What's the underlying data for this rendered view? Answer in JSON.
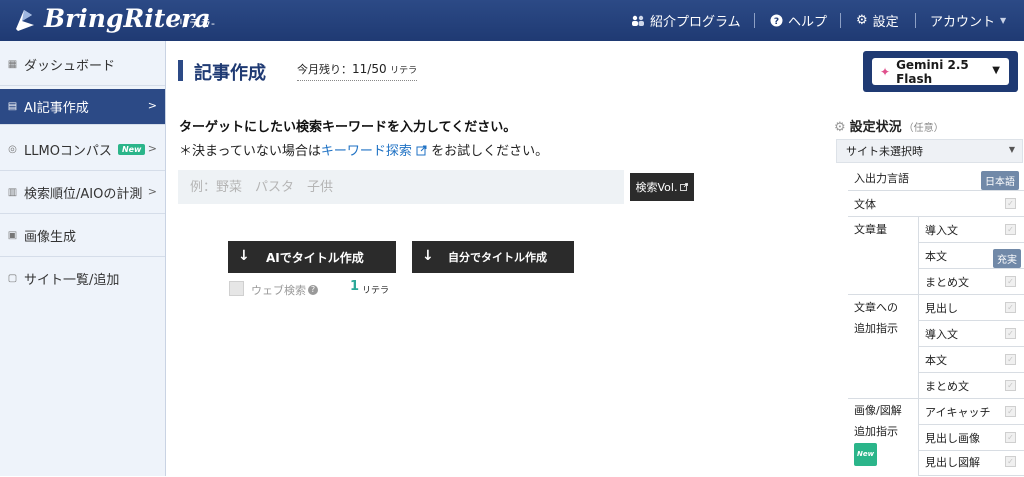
{
  "header": {
    "logo_text": "BringRitera",
    "logo_sub": "-リテラ-",
    "nav": [
      {
        "label": "紹介プログラム",
        "icon": "people-icon"
      },
      {
        "label": "ヘルプ",
        "icon": "help-icon"
      },
      {
        "label": "設定",
        "icon": "gear-icon"
      },
      {
        "label": "アカウント",
        "icon": "chevron-down-icon"
      }
    ]
  },
  "sidebar": {
    "items": [
      {
        "label": "ダッシュボード",
        "icon": "dashboard-icon"
      },
      {
        "label": "AI記事作成",
        "icon": "article-icon",
        "active": true
      },
      {
        "label": "LLMOコンパス",
        "icon": "compass-icon",
        "badge": "New"
      },
      {
        "label": "検索順位/AIOの計測",
        "icon": "ranking-icon"
      },
      {
        "label": "画像生成",
        "icon": "image-icon"
      },
      {
        "label": "サイト一覧/追加",
        "icon": "site-icon"
      }
    ]
  },
  "main": {
    "title": "記事作成",
    "quota_label": "今月残り：",
    "quota_remaining": "11",
    "quota_total": "/50",
    "quota_unit": "リテラ",
    "model_label": "Gemini 2.5 Flash",
    "instruction": "ターゲットにしたい検索キーワードを入力してください。",
    "note_prefix": "＊決まっていない場合は",
    "note_link": "キーワード探索",
    "note_suffix": "をお試しください。",
    "keyword_placeholder": "例：野菜　パスタ　子供",
    "volume_button": "検索Vol.",
    "ai_title_button": "AIでタイトル作成",
    "self_title_button": "自分でタイトル作成",
    "web_search_label": "ウェブ検索",
    "cost_value": "1",
    "cost_unit": "リテラ"
  },
  "settings": {
    "title": "設定状況",
    "optional": "（任意）",
    "site_select": "サイト未選択時",
    "rows": {
      "io_language": "入出力言語",
      "io_language_tag": "日本語",
      "style": "文体",
      "volume": "文章量",
      "volume_intro": "導入文",
      "volume_body": "本文",
      "volume_body_tag": "充実",
      "volume_summary": "まとめ文",
      "extra_group_1": "文章への",
      "extra_group_2": "追加指示",
      "extra_heading": "見出し",
      "extra_intro": "導入文",
      "extra_body": "本文",
      "extra_summary": "まとめ文",
      "image_group_1": "画像/図解",
      "image_group_2": "追加指示",
      "image_badge": "New",
      "image_eyecatch": "アイキャッチ",
      "image_heading": "見出し画像",
      "image_diagram": "見出し図解"
    }
  },
  "colors": {
    "header_bg": "#1f3a73",
    "sidebar_active": "#2c4a86",
    "badge_green": "#2bb58a",
    "link_blue": "#1f72c4",
    "cost_teal": "#2ba898"
  }
}
